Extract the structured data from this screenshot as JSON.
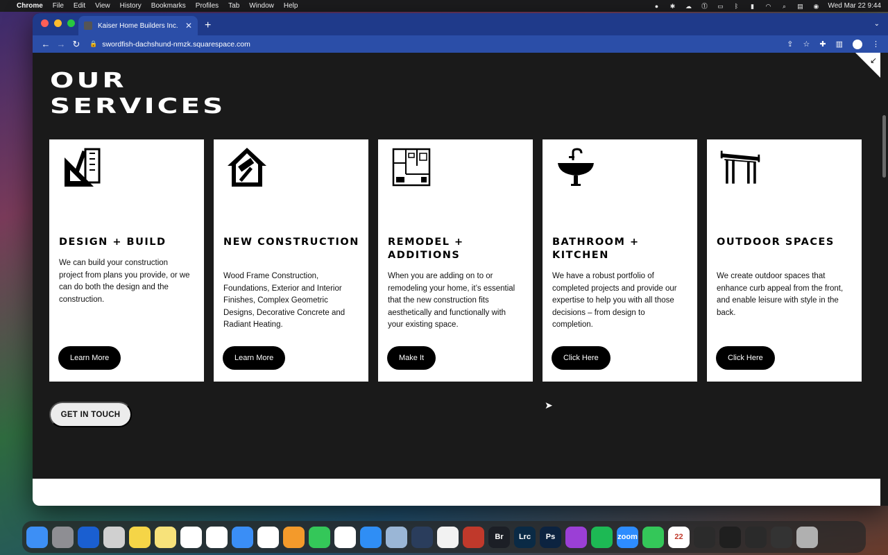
{
  "menubar": {
    "items": [
      "Chrome",
      "File",
      "Edit",
      "View",
      "History",
      "Bookmarks",
      "Profiles",
      "Tab",
      "Window",
      "Help"
    ],
    "datetime": "Wed Mar 22  9:44"
  },
  "browser": {
    "tab_title": "Kaiser Home Builders Inc.",
    "url": "swordfish-dachshund-nmzk.squarespace.com"
  },
  "page": {
    "section_title_line1": "OUR",
    "section_title_line2": "SERVICES",
    "cards": [
      {
        "icon": "design-tools-icon",
        "title": "DESIGN + BUILD",
        "description": "We can build your construction project from plans you provide, or we can do both the design and the construction.",
        "button": "Learn More"
      },
      {
        "icon": "house-hammer-icon",
        "title": "NEW CONSTRUCTION",
        "description": "Wood Frame Construction, Foundations, Exterior and Interior Finishes, Complex Geometric Designs, Decorative Concrete and Radiant Heating.",
        "button": "Learn More"
      },
      {
        "icon": "floor-plan-icon",
        "title": "REMODEL + ADDITIONS",
        "description": "When you are adding on to or remodeling your home, it’s essential that the new construction fits aesthetically and functionally with your existing space.",
        "button": "Make It"
      },
      {
        "icon": "sink-faucet-icon",
        "title": "BATHROOM + KITCHEN",
        "description": "We have a robust portfolio of completed projects and provide our expertise to help you with all those decisions – from design to completion.",
        "button": "Click Here"
      },
      {
        "icon": "pergola-icon",
        "title": "OUTDOOR SPACES",
        "description": "We create outdoor spaces that enhance curb appeal from the front, and enable leisure with style in the back.",
        "button": "Click Here"
      }
    ],
    "cta_button": "GET IN TOUCH"
  },
  "dock": {
    "apps": [
      {
        "name": "finder-icon",
        "color": "#3d8ff5",
        "label": ""
      },
      {
        "name": "system-settings-icon",
        "color": "#8e8e93",
        "label": ""
      },
      {
        "name": "1password-icon",
        "color": "#1a5fd1",
        "label": ""
      },
      {
        "name": "launchpad-icon",
        "color": "#d0d0d0",
        "label": ""
      },
      {
        "name": "stickies-icon",
        "color": "#f5d547",
        "label": ""
      },
      {
        "name": "notes-icon",
        "color": "#f7e27a",
        "label": ""
      },
      {
        "name": "reminders-icon",
        "color": "#ffffff",
        "label": ""
      },
      {
        "name": "calendar-icon",
        "color": "#ffffff",
        "label": ""
      },
      {
        "name": "mail-icon",
        "color": "#3a8ef6",
        "label": ""
      },
      {
        "name": "slack-icon",
        "color": "#ffffff",
        "label": ""
      },
      {
        "name": "pages-icon",
        "color": "#f39a2b",
        "label": ""
      },
      {
        "name": "messages-icon",
        "color": "#34c759",
        "label": ""
      },
      {
        "name": "chrome-icon",
        "color": "#ffffff",
        "label": ""
      },
      {
        "name": "safari-icon",
        "color": "#2f8ef5",
        "label": ""
      },
      {
        "name": "preview-icon",
        "color": "#9ab6d6",
        "label": ""
      },
      {
        "name": "quicktime-icon",
        "color": "#2a3d5c",
        "label": ""
      },
      {
        "name": "photos-icon",
        "color": "#f2f2f2",
        "label": ""
      },
      {
        "name": "photo-booth-icon",
        "color": "#c0392b",
        "label": ""
      },
      {
        "name": "bridge-icon",
        "color": "#1c1f26",
        "label": "Br"
      },
      {
        "name": "lightroom-classic-icon",
        "color": "#0a2a45",
        "label": "Lrc"
      },
      {
        "name": "photoshop-icon",
        "color": "#0c2340",
        "label": "Ps"
      },
      {
        "name": "podcasts-icon",
        "color": "#9b3fd6",
        "label": ""
      },
      {
        "name": "spotify-icon",
        "color": "#1db954",
        "label": ""
      },
      {
        "name": "zoom-icon",
        "color": "#2d8cff",
        "label": "zoom"
      },
      {
        "name": "facetime-icon",
        "color": "#34c759",
        "label": ""
      },
      {
        "name": "calendar-date-icon",
        "color": "#ffffff",
        "label": "22"
      },
      {
        "name": "window-thumb-1-icon",
        "color": "#2b2b2b",
        "label": ""
      },
      {
        "name": "window-thumb-2-icon",
        "color": "#1f1f1f",
        "label": ""
      },
      {
        "name": "window-thumb-3-icon",
        "color": "#2a2a2a",
        "label": ""
      },
      {
        "name": "window-thumb-4-icon",
        "color": "#333333",
        "label": ""
      },
      {
        "name": "trash-icon",
        "color": "#b0b0b0",
        "label": ""
      }
    ]
  }
}
